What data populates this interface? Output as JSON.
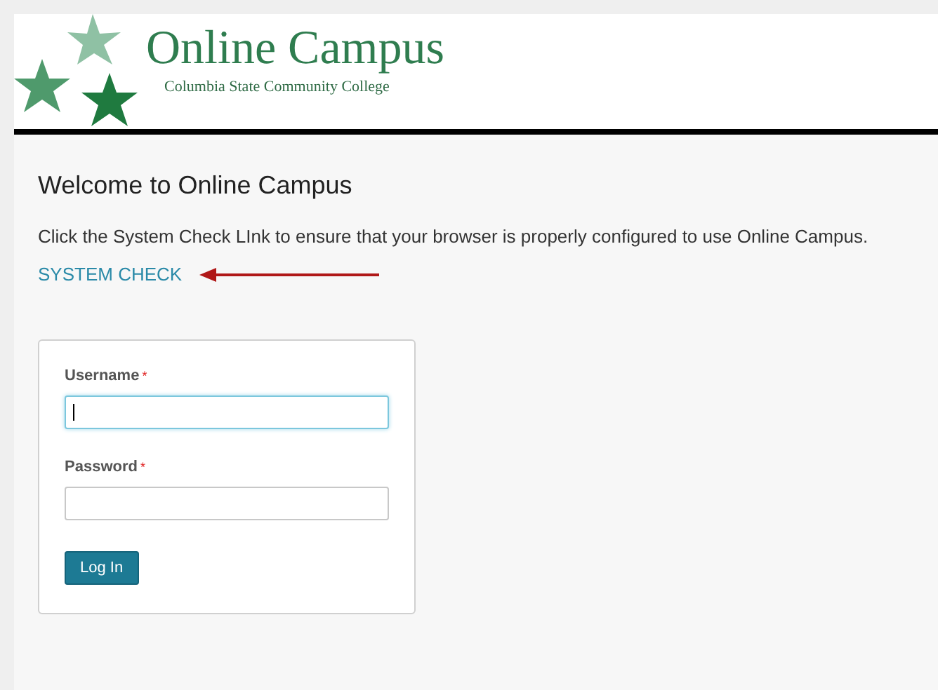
{
  "header": {
    "title": "Online Campus",
    "subtitle": "Columbia State Community College"
  },
  "welcome": {
    "heading": "Welcome to Online Campus",
    "text": "Click the System Check LInk to ensure that your browser is properly configured to use Online Campus.",
    "link": "SYSTEM CHECK"
  },
  "login": {
    "fields": [
      {
        "label": "Username",
        "required_mark": "*",
        "focused": true
      },
      {
        "label": "Password",
        "required_mark": "*",
        "focused": false
      }
    ],
    "button": "Log In"
  }
}
